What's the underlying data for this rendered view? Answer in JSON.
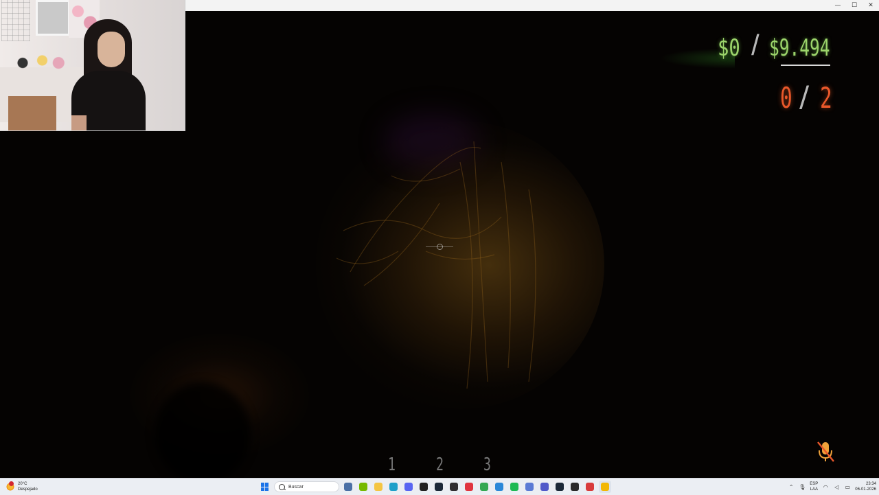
{
  "window": {
    "minimize_glyph": "—",
    "maximize_glyph": "☐",
    "close_glyph": "✕"
  },
  "hud": {
    "money_current": "$0",
    "money_separator": "/",
    "money_total": "$9.494",
    "objective_found": "0",
    "objective_separator": "/",
    "objective_total": "2",
    "hotbar_slots": [
      "1",
      "2",
      "3"
    ],
    "colors": {
      "money_green": "#9cd46b",
      "objective_orange": "#e8572a",
      "separator_gray": "#b8b8b8"
    }
  },
  "taskbar": {
    "weather_temp": "20°C",
    "weather_desc": "Despejado",
    "search_placeholder": "Buscar",
    "lang_line1": "ESP",
    "lang_line2": "LAA",
    "time": "23:34",
    "date": "06-01-2026",
    "apps": [
      {
        "name": "widgets",
        "color": "#4a6fa5"
      },
      {
        "name": "nvidia",
        "color": "#76b900"
      },
      {
        "name": "file-explorer",
        "color": "#f4c542"
      },
      {
        "name": "edge",
        "color": "#1fa0c9"
      },
      {
        "name": "discord",
        "color": "#5865f2"
      },
      {
        "name": "capcut",
        "color": "#222222"
      },
      {
        "name": "steam",
        "color": "#1b2838"
      },
      {
        "name": "obs",
        "color": "#302e31"
      },
      {
        "name": "opera",
        "color": "#e0343f"
      },
      {
        "name": "chrome",
        "color": "#34a853"
      },
      {
        "name": "store",
        "color": "#2b88d8"
      },
      {
        "name": "spotify",
        "color": "#1db954"
      },
      {
        "name": "app-blue",
        "color": "#5b7bd5"
      },
      {
        "name": "teams",
        "color": "#5059c9"
      },
      {
        "name": "steam-2",
        "color": "#1b2838"
      },
      {
        "name": "epic",
        "color": "#2a2a2a"
      },
      {
        "name": "app-red",
        "color": "#d83b3b"
      },
      {
        "name": "game-active",
        "color": "#f2b705"
      }
    ]
  }
}
